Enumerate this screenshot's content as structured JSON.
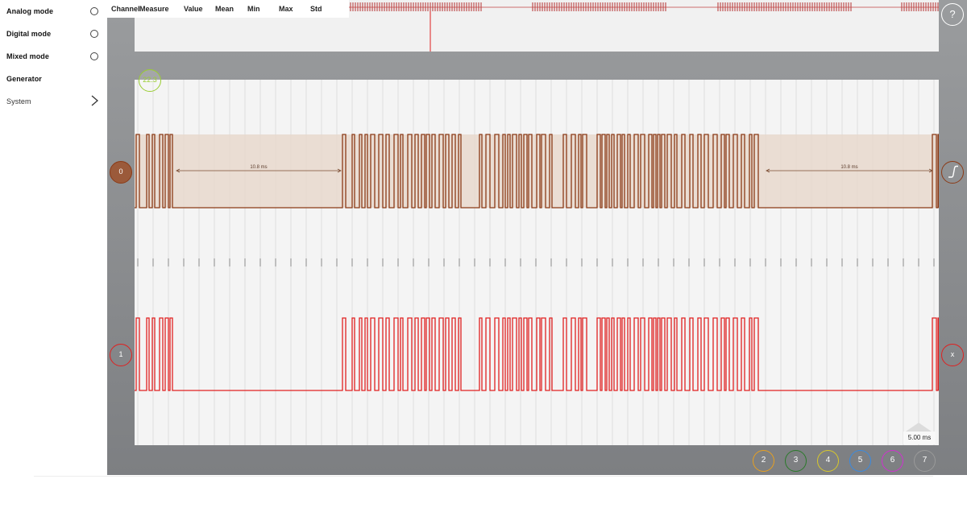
{
  "sidebar": {
    "items": [
      {
        "label": "Analog mode",
        "control": "radio-unselected"
      },
      {
        "label": "Digital mode",
        "control": "radio-unselected"
      },
      {
        "label": "Mixed mode",
        "control": "radio-unselected"
      },
      {
        "label": "Generator",
        "control": "none"
      },
      {
        "label": "System",
        "control": "chevron-right"
      }
    ]
  },
  "measure": {
    "headers": [
      "Channel",
      "Measure",
      "Value",
      "Mean",
      "Min",
      "Max",
      "Std"
    ]
  },
  "plot": {
    "trigger_level_label": "22.3",
    "channels": [
      {
        "label": "0",
        "color": "#8b3a16",
        "fill": "#e8d8cc"
      },
      {
        "label": "1",
        "color": "#e02020"
      }
    ],
    "intervals": [
      {
        "label": "10.8 ms"
      },
      {
        "label": "10.8 ms"
      }
    ],
    "timebase": "5.00 ms"
  },
  "right_controls": {
    "help_label": "?",
    "trigger_edge_icon": "rising-edge-icon",
    "close_label": "x"
  },
  "channel_buttons": [
    {
      "label": "2",
      "color": "#e8a020"
    },
    {
      "label": "3",
      "color": "#2a7a2a"
    },
    {
      "label": "4",
      "color": "#d8c82a"
    },
    {
      "label": "5",
      "color": "#3a8ae0"
    },
    {
      "label": "6",
      "color": "#d030d0"
    },
    {
      "label": "7",
      "color": "#9a9a9a"
    }
  ],
  "colors": {
    "accent_trigger": "#9acd32",
    "channel0": "#8b3a16",
    "channel1": "#e02020",
    "cursor": "#e02020"
  }
}
